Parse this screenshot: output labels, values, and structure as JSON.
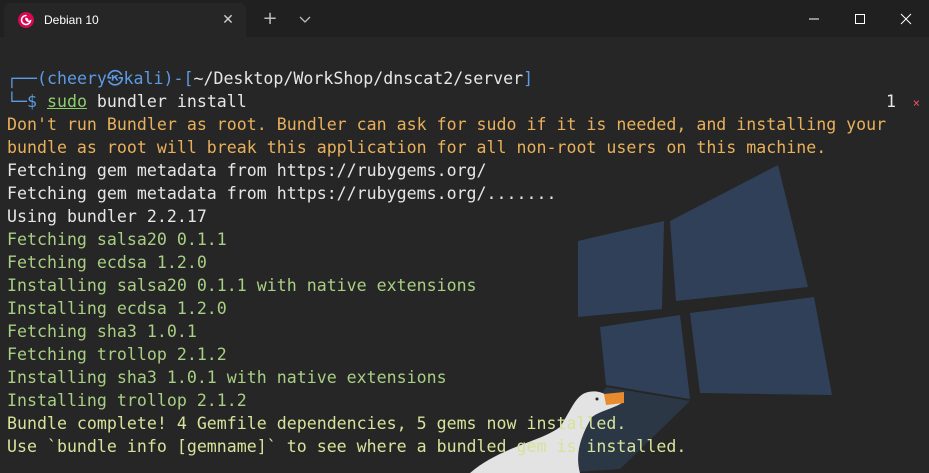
{
  "tab": {
    "title": "Debian 10",
    "icon": "debian-swirl-icon",
    "close_icon": "close-icon"
  },
  "titlebar": {
    "new_tab_icon": "plus-icon",
    "dropdown_icon": "chevron-down-icon",
    "minimize_icon": "minimize-icon",
    "maximize_icon": "maximize-icon",
    "close_icon": "close-icon"
  },
  "prompt": {
    "open": "┌──(",
    "user": "cheery",
    "at": "㉿",
    "host": "kali",
    "sep": ")-[",
    "path": "~/Desktop/WorkShop/dnscat2/server",
    "close": "]",
    "corner": "└─$ ",
    "cmd_sudo": "sudo",
    "cmd_rest": " bundler install"
  },
  "status": {
    "exit_code": "1",
    "error_mark": "×"
  },
  "output": [
    "Don't run Bundler as root. Bundler can ask for sudo if it is needed, and installing your",
    "bundle as root will break this application for all non-root users on this machine.",
    "Fetching gem metadata from https://rubygems.org/",
    "Fetching gem metadata from https://rubygems.org/.......",
    "Using bundler 2.2.17",
    "Fetching salsa20 0.1.1",
    "Fetching ecdsa 1.2.0",
    "Installing salsa20 0.1.1 with native extensions",
    "Installing ecdsa 1.2.0",
    "Fetching sha3 1.0.1",
    "Fetching trollop 2.1.2",
    "Installing sha3 1.0.1 with native extensions",
    "Installing trollop 2.1.2",
    "Bundle complete! 4 Gemfile dependencies, 5 gems now installed.",
    "Use `bundle info [gemname]` to see where a bundled gem is installed."
  ],
  "colors": {
    "warning": "#e9b05a",
    "success": "#8ccf6b",
    "prompt": "#5c9ae3",
    "error": "#ef4e67"
  },
  "background_art": "windows-logo-with-goose"
}
